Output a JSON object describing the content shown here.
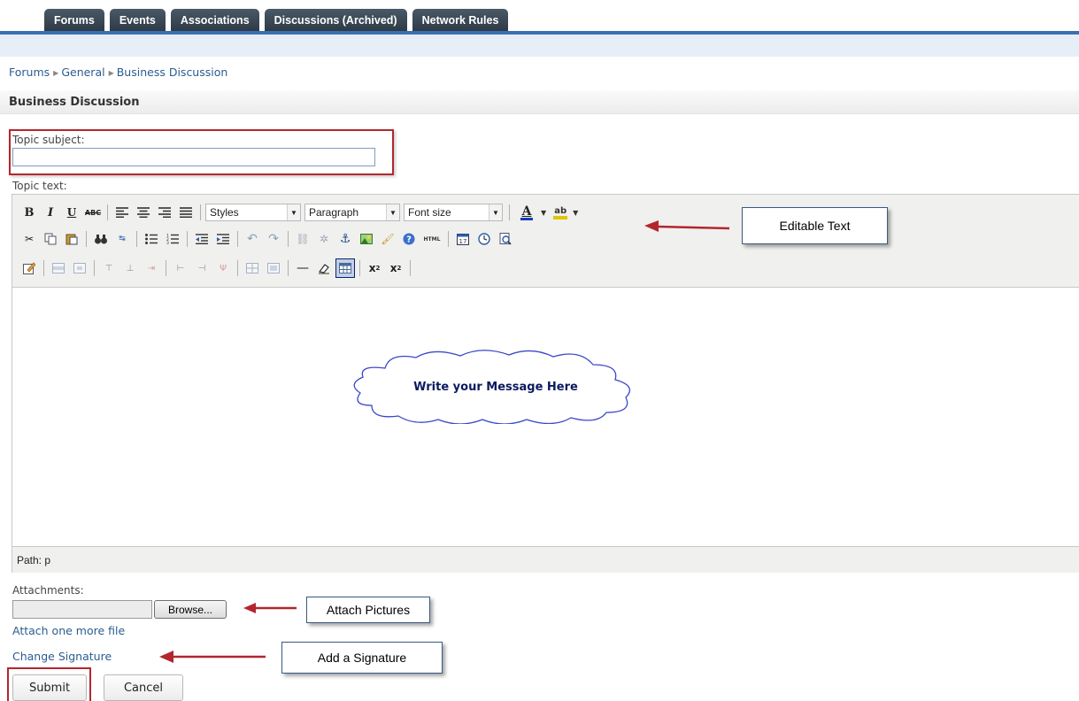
{
  "tabs": [
    "Forums",
    "Events",
    "Associations",
    "Discussions (Archived)",
    "Network Rules"
  ],
  "breadcrumb": [
    "Forums",
    "General",
    "Business Discussion"
  ],
  "page_title": "Business Discussion",
  "form": {
    "subject_label": "Topic subject:",
    "subject_value": "",
    "text_label": "Topic text:",
    "attachments_label": "Attachments:",
    "browse_label": "Browse...",
    "attach_more_link": "Attach one more file",
    "change_signature_link": "Change Signature",
    "submit_label": "Submit",
    "cancel_label": "Cancel"
  },
  "editor": {
    "styles_select": "Styles",
    "format_select": "Paragraph",
    "fontsize_select": "Font size",
    "path_text": "Path: p",
    "placeholder_cloud": "Write your Message Here"
  },
  "callouts": {
    "editable_text": "Editable Text",
    "attach_pictures": "Attach Pictures",
    "add_signature": "Add a Signature"
  },
  "colors": {
    "tab_bg": "#34414e",
    "tab_line": "#3b6fb2",
    "link": "#2a5d8f",
    "highlight": "#b3262e",
    "arrow": "#b3262e"
  }
}
